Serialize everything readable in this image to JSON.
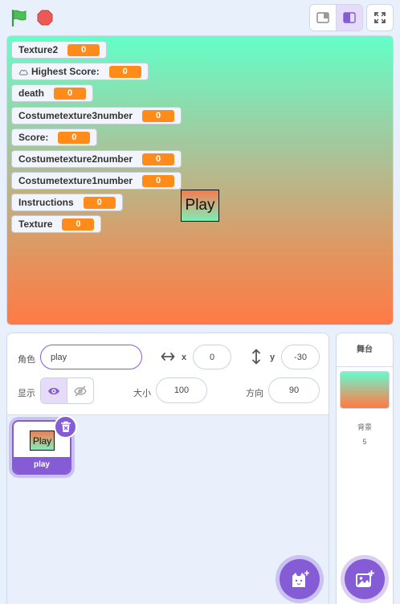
{
  "monitors": [
    {
      "label": "Texture2",
      "value": "0",
      "cloud": false
    },
    {
      "label": "Highest Score:",
      "value": "0",
      "cloud": true
    },
    {
      "label": "death",
      "value": "0",
      "cloud": false
    },
    {
      "label": "Costumetexture3number",
      "value": "0",
      "cloud": false
    },
    {
      "label": "Score:",
      "value": "0",
      "cloud": false
    },
    {
      "label": "Costumetexture2number",
      "value": "0",
      "cloud": false
    },
    {
      "label": "Costumetexture1number",
      "value": "0",
      "cloud": false
    },
    {
      "label": "Instructions",
      "value": "0",
      "cloud": false
    },
    {
      "label": "Texture",
      "value": "0",
      "cloud": false
    }
  ],
  "stage_sprite": {
    "text": "Play"
  },
  "sprite_info": {
    "sprite_label": "角色",
    "sprite_name": "play",
    "x_label": "x",
    "x_value": "0",
    "y_label": "y",
    "y_value": "-30",
    "show_label": "显示",
    "size_label": "大小",
    "size_value": "100",
    "direction_label": "方向",
    "direction_value": "90"
  },
  "sprite_tile": {
    "thumb_text": "Play",
    "name": "play"
  },
  "stage_panel": {
    "title": "舞台",
    "backdrops_label": "背景",
    "backdrops_count": "5"
  },
  "colors": {
    "accent": "#855cd6",
    "monitor_value": "#ff8c1a",
    "flag": "#4cbf56",
    "stop": "#ec5959"
  }
}
